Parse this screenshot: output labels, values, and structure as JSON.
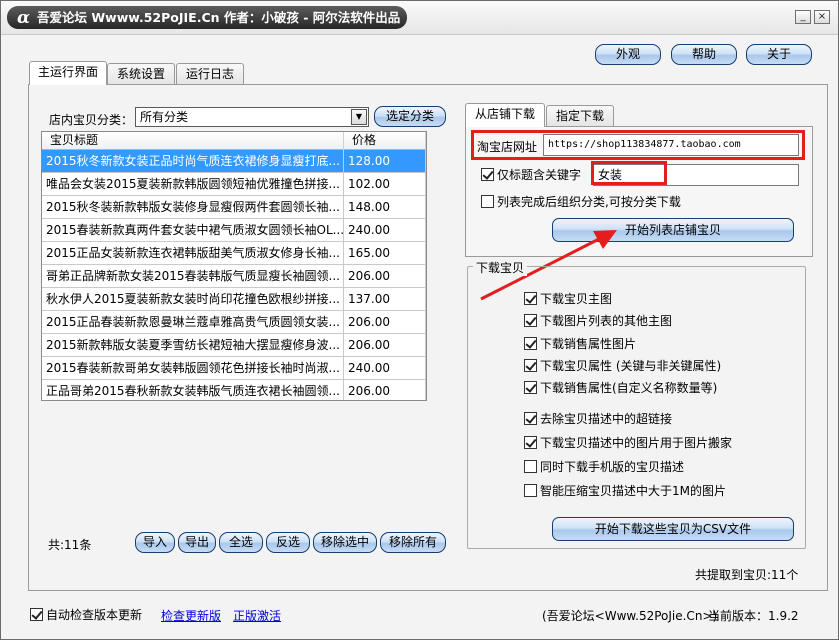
{
  "window": {
    "logo": "α",
    "title": "吾爱论坛 Wwww.52PoJIE.Cn  作者：小破孩 - 阿尔法软件出品",
    "minimize_glyph": "_",
    "close_glyph": "×"
  },
  "header_buttons": {
    "appearance": "外观",
    "help": "帮助",
    "about": "关于"
  },
  "main_tabs": {
    "main": "主运行界面",
    "settings": "系统设置",
    "log": "运行日志"
  },
  "category": {
    "label": "店内宝贝分类：",
    "selected": "所有分类",
    "select_button": "选定分类"
  },
  "table": {
    "columns": [
      "宝贝标题",
      "价格"
    ],
    "rows": [
      {
        "title": "2015秋冬新款女装正品时尚气质连衣裙修身显瘦打底...",
        "price": "128.00"
      },
      {
        "title": "唯品会女装2015夏装新款韩版圆领短袖优雅撞色拼接...",
        "price": "102.00"
      },
      {
        "title": "2015秋冬装新款韩版女装修身显瘦假两件套圆领长袖...",
        "price": "148.00"
      },
      {
        "title": "2015春装新款真两件套女装中裙气质淑女圆领长袖OL...",
        "price": "240.00"
      },
      {
        "title": "2015正品女装新款连衣裙韩版甜美气质淑女修身长袖...",
        "price": "165.00"
      },
      {
        "title": "哥弟正品牌新款女装2015春装韩版气质显瘦长袖圆领...",
        "price": "206.00"
      },
      {
        "title": "秋水伊人2015夏装新款女装时尚印花撞色欧根纱拼接...",
        "price": "137.00"
      },
      {
        "title": "2015正品春装新款恩曼琳兰蔻卓雅高贵气质圆领女装...",
        "price": "206.00"
      },
      {
        "title": "2015新款韩版女装夏季雪纺长裙短袖大摆显瘦修身波...",
        "price": "206.00"
      },
      {
        "title": "2015春装新款哥弟女装韩版圆领花色拼接长袖时尚淑...",
        "price": "240.00"
      },
      {
        "title": "正品哥弟2015春秋新款女装韩版气质连衣裙长袖圆领...",
        "price": "206.00"
      }
    ],
    "selected_index": 0
  },
  "bottom_bar": {
    "total": "共:11条",
    "import": "导入",
    "export": "导出",
    "select_all": "全选",
    "invert": "反选",
    "remove_selected": "移除选中",
    "remove_all": "移除所有"
  },
  "right_tabs": {
    "from_shop": "从店铺下载",
    "specified": "指定下载"
  },
  "shop": {
    "url_label": "淘宝店网址",
    "url_value": "https://shop113834877.taobao.com",
    "keyword_label": "仅标题含关键字",
    "keyword_value": "女装",
    "keyword_checked": true,
    "group_label": "列表完成后组织分类,可按分类下载",
    "group_checked": false,
    "start_list_button": "开始列表店铺宝贝"
  },
  "download": {
    "group_title": "下载宝贝",
    "options": [
      {
        "label": "下载宝贝主图",
        "checked": true
      },
      {
        "label": "下载图片列表的其他主图",
        "checked": true
      },
      {
        "label": "下载销售属性图片",
        "checked": true
      },
      {
        "label": "下载宝贝属性 (关键与非关键属性)",
        "checked": true
      },
      {
        "label": "下载销售属性(自定义名称数量等)",
        "checked": true
      },
      {
        "label": "去除宝贝描述中的超链接",
        "checked": true
      },
      {
        "label": "下载宝贝描述中的图片用于图片搬家",
        "checked": true
      },
      {
        "label": "同时下载手机版的宝贝描述",
        "checked": false
      },
      {
        "label": "智能压缩宝贝描述中大于1M的图片",
        "checked": false
      }
    ],
    "start_button": "开始下载这些宝贝为CSV文件",
    "extracted": "共提取到宝贝:11个"
  },
  "footer": {
    "auto_check_label": "自动检查版本更新",
    "auto_check_checked": true,
    "check_update": "检查更新版",
    "activate": "正版激活",
    "site": "(吾爱论坛<Www.52PoJie.Cn>)",
    "version": "当前版本：1.9.2"
  },
  "colors": {
    "annotation_red": "#e51d1d",
    "selection": "#3399ff"
  }
}
